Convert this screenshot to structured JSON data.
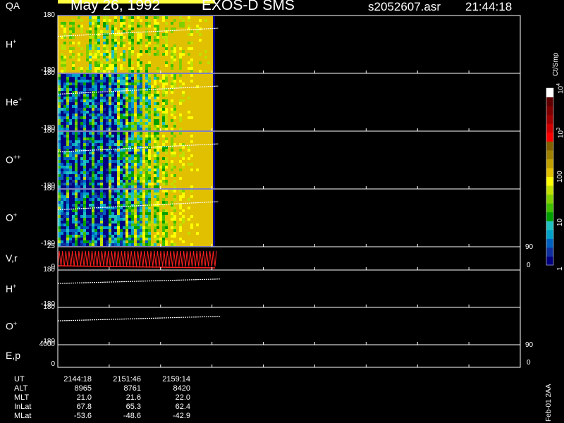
{
  "header": {
    "date": "May 26, 1992",
    "instrument": "EXOS-D SMS",
    "file": "s2052607.asr",
    "time": "21:44:18"
  },
  "colorbar": {
    "unit": "Ct/Smp",
    "tick_labels": [
      "10",
      "10",
      "100",
      "10",
      "1"
    ],
    "tick_exps": [
      "4",
      "3",
      "",
      "",
      ""
    ],
    "tick_values": [
      10000,
      1000,
      100,
      10,
      1
    ],
    "scale": "log",
    "colors": [
      "#000080",
      "#1030a0",
      "#0060c0",
      "#00a0c8",
      "#20c0c0",
      "#00a000",
      "#40c000",
      "#80d000",
      "#c0e000",
      "#ffff00",
      "#e0c000",
      "#c0a000",
      "#a08000",
      "#806000",
      "#ff0000",
      "#d00000",
      "#a00000",
      "#800000",
      "#600000",
      "#ffffff"
    ]
  },
  "footer": {
    "stamp": "Feb-01 2AA",
    "table_labels": [
      "UT",
      "ALT",
      "MLT",
      "InLat",
      "MLat"
    ],
    "table_values": [
      [
        "2144:18",
        "2151:46",
        "2159:14"
      ],
      [
        "8965",
        "8761",
        "8420"
      ],
      [
        "21.0",
        "21.6",
        "22.0"
      ],
      [
        "67.8",
        "65.3",
        "62.4"
      ],
      [
        "-53.6",
        "-48.6",
        "-42.9"
      ]
    ]
  },
  "chart_data": {
    "type": "heatmap",
    "x_axis": {
      "label": "UT",
      "tick_labels": [
        "2144:18",
        "2151:46",
        "2159:14"
      ],
      "data_fraction_end": 0.34
    },
    "panels": [
      {
        "label": "H",
        "sup": "+",
        "kind": "spectrogram",
        "ytop": "180",
        "ybot": "-180",
        "ylim": [
          -180,
          180
        ],
        "profile": "h",
        "trend_start": 85,
        "trend_end": 100
      },
      {
        "label": "He",
        "sup": "+",
        "kind": "spectrogram",
        "ytop": "180",
        "ybot": "-180",
        "ylim": [
          -180,
          180
        ],
        "profile": "he",
        "trend_start": 62,
        "trend_end": 106
      },
      {
        "label": "O",
        "sup": "++",
        "kind": "spectrogram",
        "ytop": "180",
        "ybot": "-180",
        "ylim": [
          -180,
          180
        ],
        "profile": "o",
        "trend_start": 60,
        "trend_end": 103
      },
      {
        "label": "O",
        "sup": "+",
        "kind": "spectrogram",
        "ytop": "180",
        "ybot": "-180",
        "ylim": [
          -180,
          180
        ],
        "profile": "o",
        "trend_start": 63,
        "trend_end": 110
      },
      {
        "label": "V,r",
        "sup": "",
        "kind": "lines",
        "ytop": "25",
        "ybot": "0",
        "ylim": [
          0,
          25
        ],
        "right_top": "90",
        "right_bot": "0"
      },
      {
        "label": "H",
        "sup": "+",
        "kind": "trend",
        "ytop": "180",
        "ybot": "-180",
        "ylim": [
          -180,
          180
        ],
        "trend_start": 43,
        "trend_end": 56
      },
      {
        "label": "O",
        "sup": "+",
        "kind": "trend",
        "ytop": "180",
        "ybot": "-180",
        "ylim": [
          -180,
          180
        ],
        "trend_start": 30,
        "trend_end": 42
      },
      {
        "label": "E,p",
        "sup": "",
        "kind": "lines",
        "ytop": "4000",
        "ybot": "0",
        "ylim": [
          0,
          4000
        ],
        "right_top": "90",
        "right_bot": "0"
      },
      {
        "label": "QA",
        "sup": "",
        "kind": "quality"
      }
    ]
  }
}
